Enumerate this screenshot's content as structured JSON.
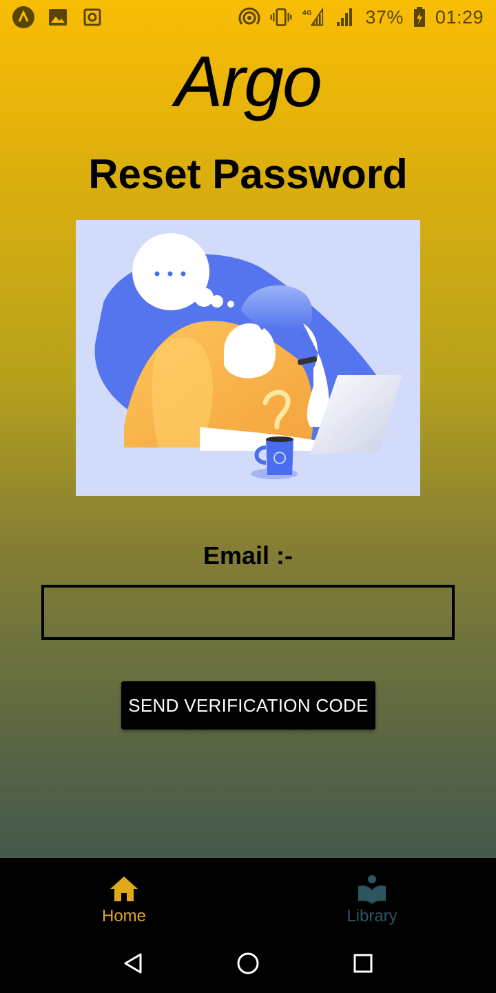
{
  "status_bar": {
    "battery": "37%",
    "time": "01:29",
    "network": "4G",
    "left_icons": [
      "app-icon",
      "image-icon",
      "camera-icon"
    ],
    "right_icons": [
      "hotspot-icon",
      "vibrate-icon",
      "signal-4g-icon",
      "signal-icon",
      "battery-charging-icon"
    ]
  },
  "header": {
    "brand": "Argo",
    "title": "Reset Password"
  },
  "form": {
    "email_label": "Email :-",
    "email_value": "",
    "email_placeholder": "",
    "send_button_label": "SEND VERIFICATION CODE"
  },
  "bottom_nav": {
    "items": [
      {
        "label": "Home",
        "icon": "home-icon",
        "active": true
      },
      {
        "label": "Library",
        "icon": "library-icon",
        "active": false
      }
    ]
  },
  "system_nav": [
    "back-icon",
    "home-circle-icon",
    "recents-icon"
  ],
  "colors": {
    "gradient_top": "#f9bd05",
    "gradient_bottom": "#2d5053",
    "active_nav": "#dfa91c",
    "inactive_nav": "#2d5560",
    "illustration_bg": "#d2dcfa",
    "illustration_accent": "#5575ee"
  }
}
